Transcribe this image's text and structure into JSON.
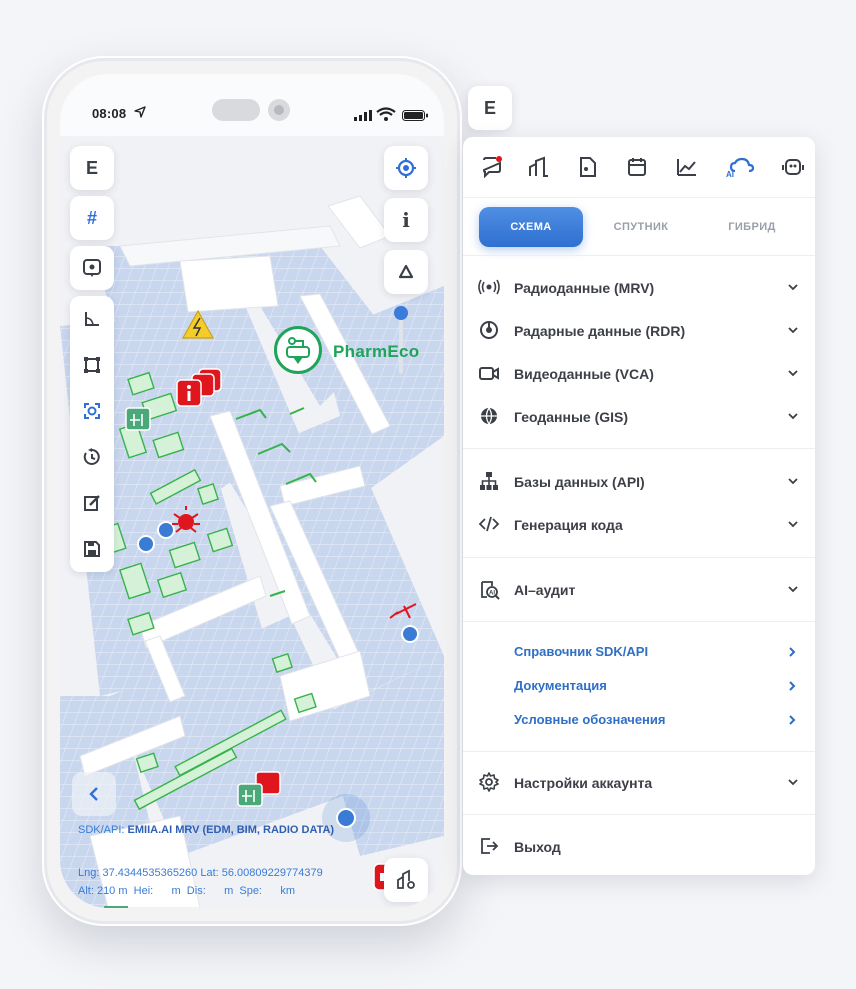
{
  "status_bar": {
    "time": "08:08"
  },
  "map": {
    "left_toolbar": {
      "mode_letter": "E",
      "grid_symbol": "#"
    },
    "right_toolbar": {
      "info_symbol": "i"
    },
    "company": {
      "name": "PharmEco"
    },
    "sdk_info": {
      "prefix": "SDK/API: ",
      "value": "EMIIA.AI MRV (EDM, BIM, RADIO DATA)"
    },
    "coords": {
      "line1": "Lng: 37.4344535365260 Lat: 56.00809229774379",
      "line2": "Alt: 210 m  Hei:      m  Dis:      m  Spe:      km"
    }
  },
  "floating_button": {
    "letter": "E"
  },
  "panel": {
    "icons": [
      "chat-alert-icon",
      "buildings-icon",
      "file-icon",
      "calendar-icon",
      "chart-line-icon",
      "ai-cloud-icon",
      "robot-icon"
    ],
    "tabs": [
      {
        "label": "СХЕМА",
        "active": true
      },
      {
        "label": "СПУТНИК",
        "active": false
      },
      {
        "label": "ГИБРИД",
        "active": false
      }
    ],
    "data_items": [
      {
        "label": "Радиоданные (MRV)",
        "icon": "radio-icon"
      },
      {
        "label": "Радарные данные (RDR)",
        "icon": "radar-icon"
      },
      {
        "label": "Видеоданные (VCA)",
        "icon": "video-icon"
      },
      {
        "label": "Геоданные (GIS)",
        "icon": "globe-icon"
      }
    ],
    "dev_items": [
      {
        "label": "Базы данных (API)",
        "icon": "database-icon"
      },
      {
        "label": "Генерация кода",
        "icon": "code-icon"
      }
    ],
    "audit_item": {
      "label": "AI–аудит",
      "icon": "ai-audit-icon"
    },
    "links": [
      {
        "label": "Справочник SDK/API"
      },
      {
        "label": "Документация"
      },
      {
        "label": "Условные обозначения"
      }
    ],
    "account_item": {
      "label": "Настройки аккаунта"
    },
    "exit_item": {
      "label": "Выход"
    },
    "colors": {
      "accent": "#2f6fd0",
      "brand_green": "#1fa45a",
      "alert_red": "#e0161f"
    }
  }
}
